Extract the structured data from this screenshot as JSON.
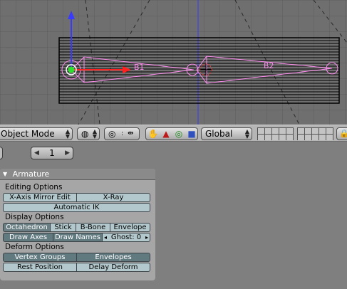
{
  "viewport": {
    "bone_labels": [
      "B1",
      "B2"
    ]
  },
  "header": {
    "mode_label": "Object Mode",
    "transform_space": "Global",
    "icons": [
      "viewport-shading-icon",
      "pivot-icon",
      "manipulator-toggle-icon",
      "hand-icon",
      "translate-icon",
      "rotate-icon",
      "scale-icon",
      "layer-grid",
      "lock-icon"
    ]
  },
  "buttons_window": {
    "frame_value": "1",
    "panel": {
      "title": "Armature",
      "editing_options": {
        "label": "Editing Options",
        "x_axis_mirror": "X-Axis Mirror Edit",
        "x_ray": "X-Ray",
        "automatic_ik": "Automatic IK"
      },
      "display_options": {
        "label": "Display Options",
        "octahedron": "Octahedron",
        "stick": "Stick",
        "bbone": "B-Bone",
        "envelope": "Envelope",
        "draw_axes": "Draw Axes",
        "draw_names": "Draw Names",
        "ghost_label": "Ghost: 0"
      },
      "deform_options": {
        "label": "Deform Options",
        "vertex_groups": "Vertex Groups",
        "envelopes": "Envelopes",
        "rest_position": "Rest Position",
        "delay_deform": "Delay Deform"
      }
    }
  },
  "colors": {
    "bone_outline": "#ff8cf0",
    "active_button": "#6a7f84",
    "inactive_button": "#b3c8cc",
    "grid_background": "#6f6f6f"
  }
}
